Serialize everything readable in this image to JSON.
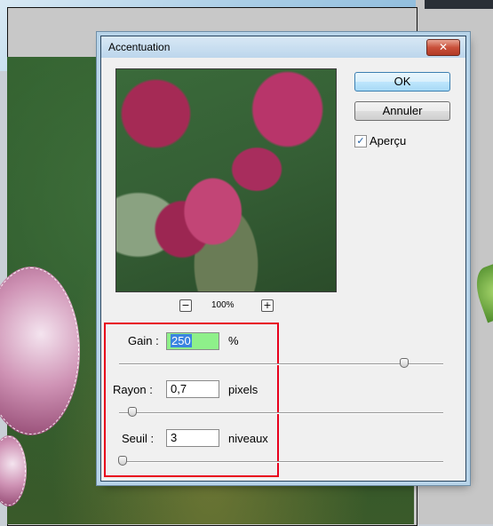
{
  "dialog": {
    "title": "Accentuation",
    "close_symbol": "✕",
    "ok_label": "OK",
    "cancel_label": "Annuler",
    "preview_checkbox": {
      "label": "Aperçu",
      "checked": true,
      "check_symbol": "✓"
    },
    "zoom": {
      "minus_symbol": "−",
      "plus_symbol": "+",
      "level": "100%"
    },
    "params": {
      "gain": {
        "label": "Gain :",
        "value": "250",
        "unit": "%",
        "slider_fraction": 0.88
      },
      "rayon": {
        "label": "Rayon :",
        "value": "0,7",
        "unit": "pixels",
        "slider_fraction": 0.04
      },
      "seuil": {
        "label": "Seuil :",
        "value": "3",
        "unit": "niveaux",
        "slider_fraction": 0.01
      }
    }
  },
  "colors": {
    "highlight_box": "#e8001c",
    "selected_field": "#8ef08a",
    "selection": "#3a84e0"
  }
}
